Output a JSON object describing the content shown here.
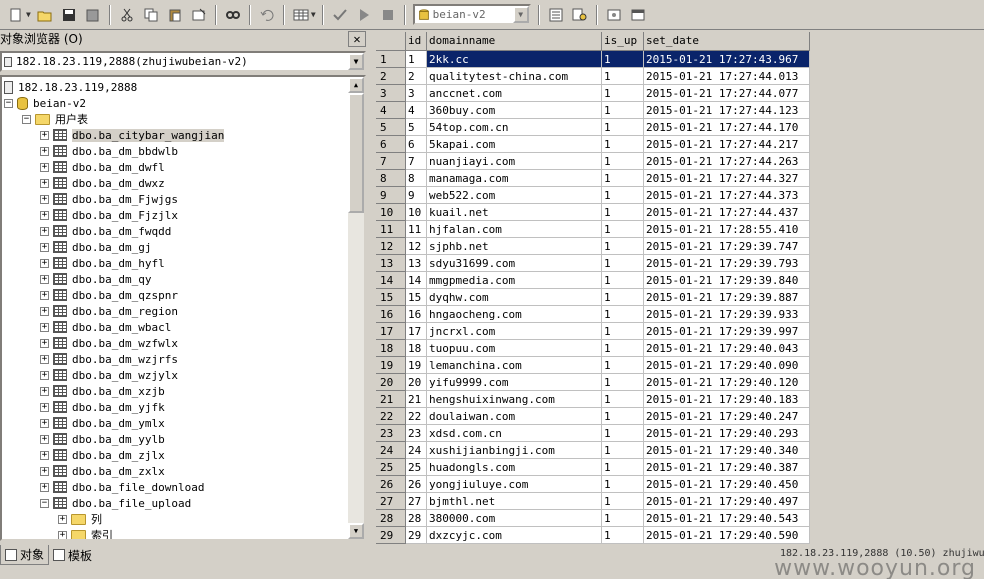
{
  "toolbar": {
    "db_selector": "beian-v2",
    "icons": [
      "new-icon",
      "open-icon",
      "save-icon",
      "save-all-icon",
      "cut-icon",
      "copy-icon",
      "paste-icon",
      "clear-icon",
      "find-icon",
      "undo-icon",
      "grid-icon",
      "check-icon",
      "run-icon",
      "stop-icon",
      "db-icon",
      "object-browser-icon",
      "object-search-icon",
      "options-icon",
      "window-icon"
    ]
  },
  "object_browser": {
    "title": "对象浏览器 (O)",
    "server_combo": "182.18.23.119,2888(zhujiwubeian-v2)",
    "server_node": "182.18.23.119,2888",
    "database_node": "beian-v2",
    "user_tables_folder": "用户表",
    "tables": [
      "dbo.ba_citybar_wangjian",
      "dbo.ba_dm_bbdwlb",
      "dbo.ba_dm_dwfl",
      "dbo.ba_dm_dwxz",
      "dbo.ba_dm_Fjwjgs",
      "dbo.ba_dm_Fjzjlx",
      "dbo.ba_dm_fwqdd",
      "dbo.ba_dm_gj",
      "dbo.ba_dm_hyfl",
      "dbo.ba_dm_qy",
      "dbo.ba_dm_qzspnr",
      "dbo.ba_dm_region",
      "dbo.ba_dm_wbacl",
      "dbo.ba_dm_wzfwlx",
      "dbo.ba_dm_wzjrfs",
      "dbo.ba_dm_wzjylx",
      "dbo.ba_dm_xzjb",
      "dbo.ba_dm_yjfk",
      "dbo.ba_dm_ymlx",
      "dbo.ba_dm_yylb",
      "dbo.ba_dm_zjlx",
      "dbo.ba_dm_zxlx",
      "dbo.ba_file_download",
      "dbo.ba_file_upload"
    ],
    "subfolders": [
      "列",
      "索引"
    ],
    "tabs": [
      "对象",
      "模板"
    ]
  },
  "grid": {
    "columns": [
      "id",
      "domainname",
      "is_up",
      "set_date"
    ],
    "rows": [
      [
        "1",
        "2kk.cc",
        "1",
        "2015-01-21 17:27:43.967"
      ],
      [
        "2",
        "qualitytest-china.com",
        "1",
        "2015-01-21 17:27:44.013"
      ],
      [
        "3",
        "anccnet.com",
        "1",
        "2015-01-21 17:27:44.077"
      ],
      [
        "4",
        "360buy.com",
        "1",
        "2015-01-21 17:27:44.123"
      ],
      [
        "5",
        "54top.com.cn",
        "1",
        "2015-01-21 17:27:44.170"
      ],
      [
        "6",
        "5kapai.com",
        "1",
        "2015-01-21 17:27:44.217"
      ],
      [
        "7",
        "nuanjiayi.com",
        "1",
        "2015-01-21 17:27:44.263"
      ],
      [
        "8",
        "manamaga.com",
        "1",
        "2015-01-21 17:27:44.327"
      ],
      [
        "9",
        "web522.com",
        "1",
        "2015-01-21 17:27:44.373"
      ],
      [
        "10",
        "kuail.net",
        "1",
        "2015-01-21 17:27:44.437"
      ],
      [
        "11",
        "hjfalan.com",
        "1",
        "2015-01-21 17:28:55.410"
      ],
      [
        "12",
        "sjphb.net",
        "1",
        "2015-01-21 17:29:39.747"
      ],
      [
        "13",
        "sdyu31699.com",
        "1",
        "2015-01-21 17:29:39.793"
      ],
      [
        "14",
        "mmgpmedia.com",
        "1",
        "2015-01-21 17:29:39.840"
      ],
      [
        "15",
        "dyqhw.com",
        "1",
        "2015-01-21 17:29:39.887"
      ],
      [
        "16",
        "hngaocheng.com",
        "1",
        "2015-01-21 17:29:39.933"
      ],
      [
        "17",
        "jncrxl.com",
        "1",
        "2015-01-21 17:29:39.997"
      ],
      [
        "18",
        "tuopuu.com",
        "1",
        "2015-01-21 17:29:40.043"
      ],
      [
        "19",
        "lemanchina.com",
        "1",
        "2015-01-21 17:29:40.090"
      ],
      [
        "20",
        "yifu9999.com",
        "1",
        "2015-01-21 17:29:40.120"
      ],
      [
        "21",
        "hengshuixinwang.com",
        "1",
        "2015-01-21 17:29:40.183"
      ],
      [
        "22",
        "doulaiwan.com",
        "1",
        "2015-01-21 17:29:40.247"
      ],
      [
        "23",
        "xdsd.com.cn",
        "1",
        "2015-01-21 17:29:40.293"
      ],
      [
        "24",
        "xushijianbingji.com",
        "1",
        "2015-01-21 17:29:40.340"
      ],
      [
        "25",
        "huadongls.com",
        "1",
        "2015-01-21 17:29:40.387"
      ],
      [
        "26",
        "yongjiuluye.com",
        "1",
        "2015-01-21 17:29:40.450"
      ],
      [
        "27",
        "bjmthl.net",
        "1",
        "2015-01-21 17:29:40.497"
      ],
      [
        "28",
        "380000.com",
        "1",
        "2015-01-21 17:29:40.543"
      ],
      [
        "29",
        "dxzcyjc.com",
        "1",
        "2015-01-21 17:29:40.590"
      ]
    ],
    "selected_row": 1
  },
  "statusbar": {
    "text": "182.18.23.119,2888 (10.50) zhujiwu",
    "watermark": "www.wooyun.org"
  },
  "colors": {
    "chrome": "#d4d0c8",
    "selection": "#0a246a"
  }
}
